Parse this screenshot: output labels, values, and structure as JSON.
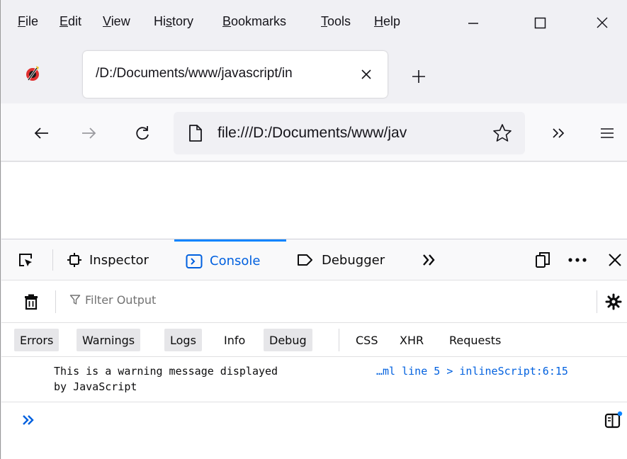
{
  "menubar": {
    "items": [
      {
        "accel": "F",
        "rest": "ile"
      },
      {
        "accel": "E",
        "rest": "dit"
      },
      {
        "accel": "V",
        "rest": "iew"
      },
      {
        "pre": "Hi",
        "accel": "s",
        "rest": "tory"
      },
      {
        "accel": "B",
        "rest": "ookmarks"
      },
      {
        "accel": "T",
        "rest": "ools"
      },
      {
        "accel": "H",
        "rest": "elp"
      }
    ],
    "window_controls": [
      "minimize-icon",
      "maximize-icon",
      "close-icon"
    ]
  },
  "tab": {
    "title": "/D:/Documents/www/javascript/in"
  },
  "navbar": {
    "url": "file:///D:/Documents/www/jav"
  },
  "devtools": {
    "tabs": {
      "inspector": "Inspector",
      "console": "Console",
      "debugger": "Debugger"
    },
    "selected_tab": "Console",
    "filter_placeholder": "Filter Output",
    "levels": {
      "errors": "Errors",
      "warnings": "Warnings",
      "logs": "Logs",
      "info": "Info",
      "debug": "Debug",
      "css": "CSS",
      "xhr": "XHR",
      "requests": "Requests"
    },
    "message": {
      "text": "This is a warning message displayed\nby JavaScript",
      "location": "…ml line 5 > inlineScript:6:15"
    }
  },
  "colors": {
    "accent": "#0060df",
    "tab_indicator": "#0a84ff",
    "checked_filter": "#e6e6e9"
  }
}
